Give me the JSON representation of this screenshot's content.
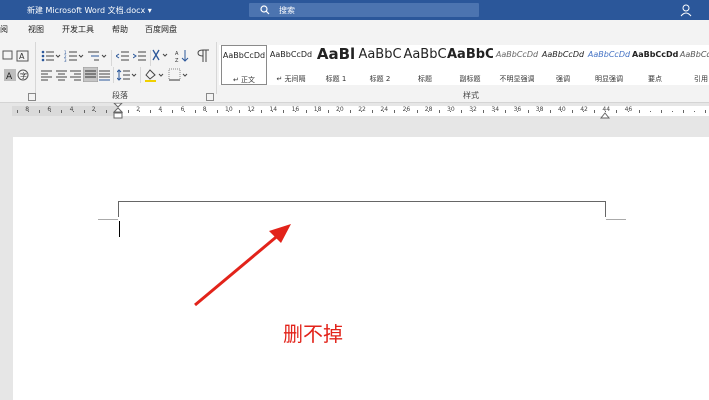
{
  "titlebar": {
    "title": "新建 Microsoft Word 文档.docx",
    "dropdown_glyph": "▾",
    "search_placeholder": "搜索",
    "color": "#2b579a"
  },
  "tabs": [
    "阅",
    "视图",
    "开发工具",
    "帮助",
    "百度网盘"
  ],
  "ribbon": {
    "paragraph_group_label": "段落",
    "styles_group_label": "样式",
    "styles": [
      {
        "sample": "AaBbCcDd",
        "name": "正文",
        "active": true,
        "name_prefix": "↵ "
      },
      {
        "sample": "AaBbCcDd",
        "name": "无间隔",
        "name_prefix": "↵ "
      },
      {
        "sample": "AaBl",
        "name": "标题 1"
      },
      {
        "sample": "AaBbC",
        "name": "标题 2"
      },
      {
        "sample": "AaBbC",
        "name": "标题"
      },
      {
        "sample": "AaBbC",
        "name": "副标题"
      },
      {
        "sample": "AaBbCcDd",
        "name": "不明显强调"
      },
      {
        "sample": "AaBbCcDd",
        "name": "强调"
      },
      {
        "sample": "AaBbCcDd",
        "name": "明显强调"
      },
      {
        "sample": "AaBbCcDd",
        "name": "要点"
      },
      {
        "sample": "AaBbCcDd",
        "name": "引用"
      }
    ]
  },
  "ruler": {
    "labels": [
      "8",
      "6",
      "4",
      "2",
      "2",
      "4",
      "6",
      "8",
      "10",
      "12",
      "14",
      "16",
      "18",
      "20",
      "22",
      "24",
      "26",
      "28",
      "30",
      "32",
      "34",
      "36",
      "38",
      "40",
      "42",
      "44",
      "46"
    ]
  },
  "document": {
    "annotation": "删不掉",
    "annotation_color": "#e2231a"
  }
}
